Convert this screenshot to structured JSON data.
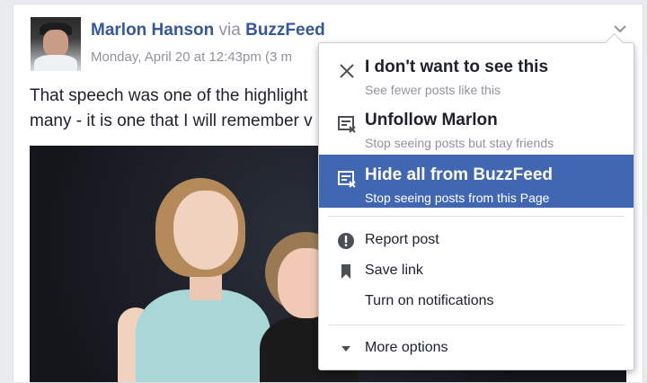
{
  "post": {
    "author": "Marlon Hanson",
    "via": "via",
    "page_name": "BuzzFeed",
    "timestamp": "Monday, April 20 at 12:43pm (3 m",
    "text_line1": "That speech was one of the highlight",
    "text_line2": "many - it is one that I will remember v"
  },
  "menu": {
    "items_primary": [
      {
        "title": "I don't want to see this",
        "subtitle": "See fewer posts like this",
        "icon": "close-icon"
      },
      {
        "title": "Unfollow Marlon",
        "subtitle": "Stop seeing posts but stay friends",
        "icon": "unfollow-icon"
      },
      {
        "title": "Hide all from BuzzFeed",
        "subtitle": "Stop seeing posts from this Page",
        "icon": "hide-page-icon",
        "highlighted": true
      }
    ],
    "items_secondary": [
      {
        "label": "Report post",
        "icon": "exclamation-icon"
      },
      {
        "label": "Save link",
        "icon": "bookmark-icon"
      },
      {
        "label": "Turn on notifications",
        "icon": ""
      }
    ],
    "more_options": {
      "label": "More options",
      "icon": "caret-down-icon"
    }
  },
  "colors": {
    "link_blue": "#365899",
    "highlight_blue": "#4267b2",
    "secondary_text": "#90949c"
  }
}
